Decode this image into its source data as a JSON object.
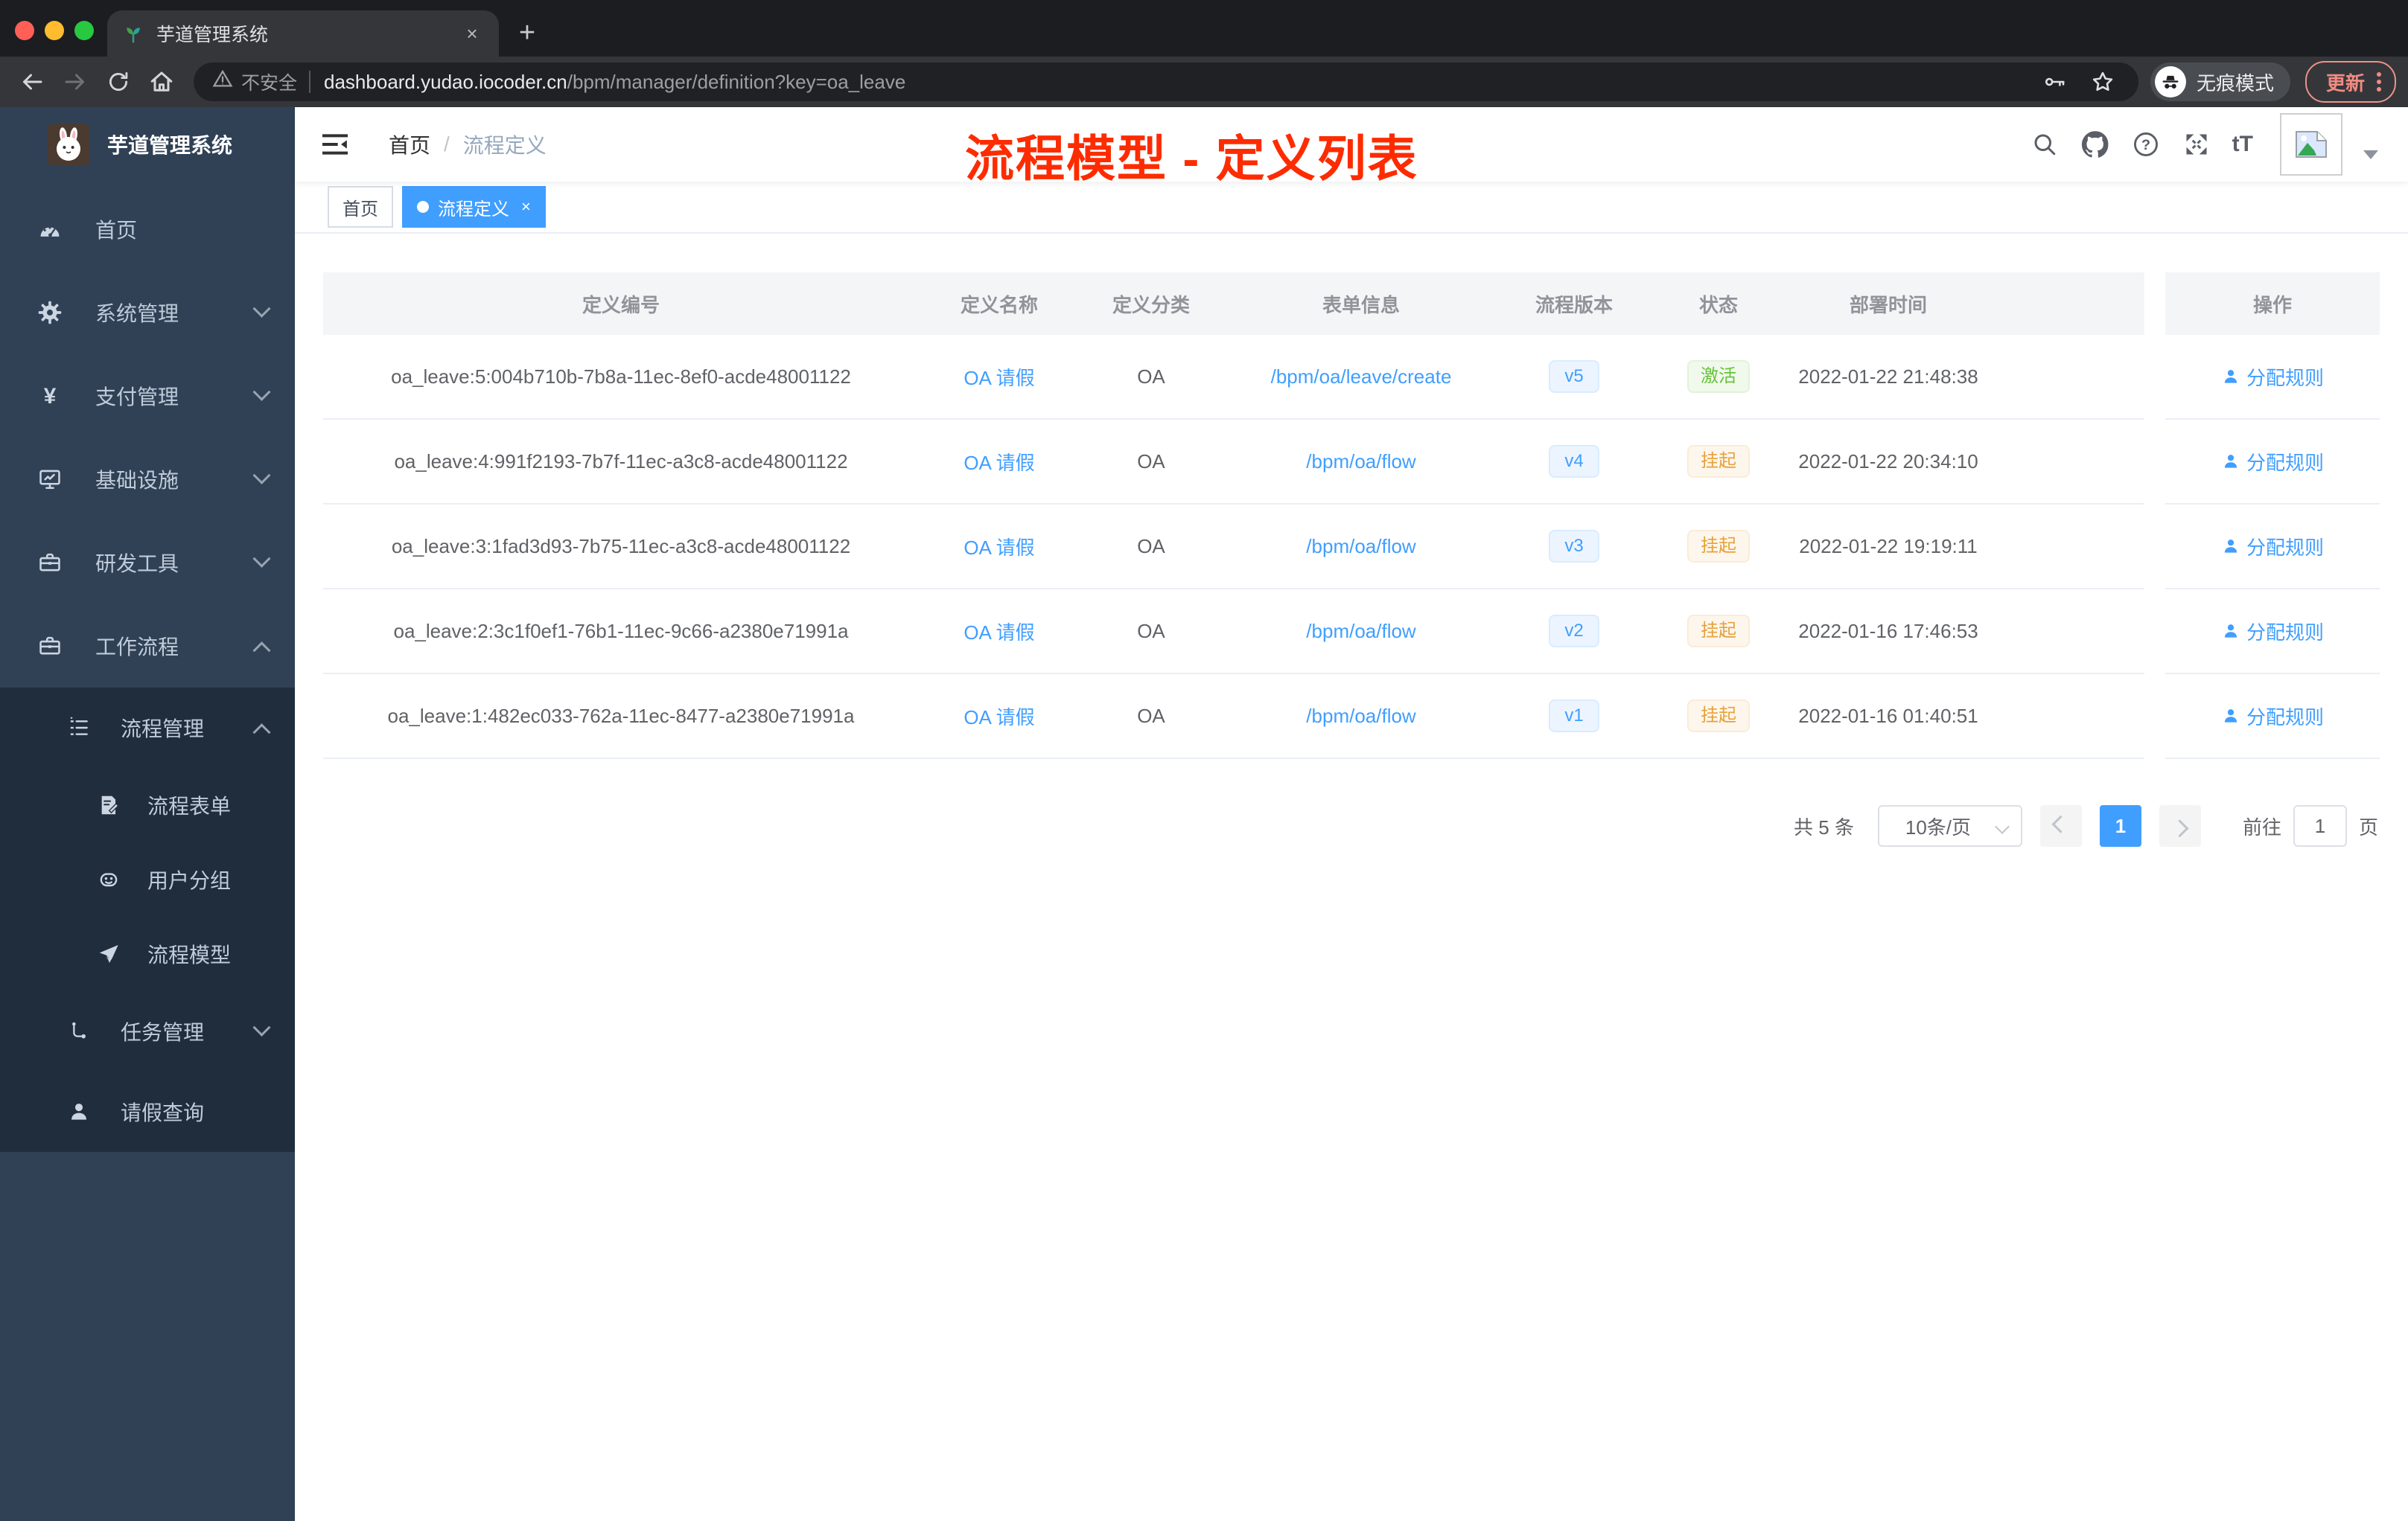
{
  "colors": {
    "accent": "#409eff",
    "annotation_red": "#fd2c00",
    "sidebar_bg": "#304156",
    "submenu_bg": "#1f2d3d",
    "success": "#67c23a",
    "warning": "#e6a23c"
  },
  "browser": {
    "tab_title": "芋道管理系统",
    "security_label": "不安全",
    "url_domain": "dashboard.yudao.iocoder.cn",
    "url_path": "/bpm/manager/definition?key=oa_leave",
    "incognito_label": "无痕模式",
    "update_label": "更新"
  },
  "icons": {
    "close": "×",
    "plus": "+",
    "yen": "¥",
    "question": "?",
    "font_size": "tT"
  },
  "sidebar": {
    "app_title": "芋道管理系统",
    "items": [
      {
        "label": "首页"
      },
      {
        "label": "系统管理"
      },
      {
        "label": "支付管理"
      },
      {
        "label": "基础设施"
      },
      {
        "label": "研发工具"
      },
      {
        "label": "工作流程"
      },
      {
        "label": "流程管理"
      },
      {
        "label": "流程表单"
      },
      {
        "label": "用户分组"
      },
      {
        "label": "流程模型"
      },
      {
        "label": "任务管理"
      },
      {
        "label": "请假查询"
      }
    ]
  },
  "navbar": {
    "breadcrumb_home": "首页",
    "breadcrumb_sep": "/",
    "breadcrumb_current": "流程定义"
  },
  "annotation": "流程模型 - 定义列表",
  "tags": {
    "home": "首页",
    "active": "流程定义"
  },
  "table": {
    "columns": [
      "定义编号",
      "定义名称",
      "定义分类",
      "表单信息",
      "流程版本",
      "状态",
      "部署时间",
      "操作"
    ],
    "rows": [
      {
        "id": "oa_leave:5:004b710b-7b8a-11ec-8ef0-acde48001122",
        "name": "OA 请假",
        "category": "OA",
        "form": "/bpm/oa/leave/create",
        "version": "v5",
        "status": "激活",
        "time": "2022-01-22 21:48:38",
        "action": "分配规则"
      },
      {
        "id": "oa_leave:4:991f2193-7b7f-11ec-a3c8-acde48001122",
        "name": "OA 请假",
        "category": "OA",
        "form": "/bpm/oa/flow",
        "version": "v4",
        "status": "挂起",
        "time": "2022-01-22 20:34:10",
        "action": "分配规则"
      },
      {
        "id": "oa_leave:3:1fad3d93-7b75-11ec-a3c8-acde48001122",
        "name": "OA 请假",
        "category": "OA",
        "form": "/bpm/oa/flow",
        "version": "v3",
        "status": "挂起",
        "time": "2022-01-22 19:19:11",
        "action": "分配规则"
      },
      {
        "id": "oa_leave:2:3c1f0ef1-76b1-11ec-9c66-a2380e71991a",
        "name": "OA 请假",
        "category": "OA",
        "form": "/bpm/oa/flow",
        "version": "v2",
        "status": "挂起",
        "time": "2022-01-16 17:46:53",
        "action": "分配规则"
      },
      {
        "id": "oa_leave:1:482ec033-762a-11ec-8477-a2380e71991a",
        "name": "OA 请假",
        "category": "OA",
        "form": "/bpm/oa/flow",
        "version": "v1",
        "status": "挂起",
        "time": "2022-01-16 01:40:51",
        "action": "分配规则"
      }
    ]
  },
  "pagination": {
    "total": "共 5 条",
    "page_size": "10条/页",
    "page": "1",
    "goto_label": "前往",
    "goto_value": "1",
    "page_unit": "页"
  }
}
